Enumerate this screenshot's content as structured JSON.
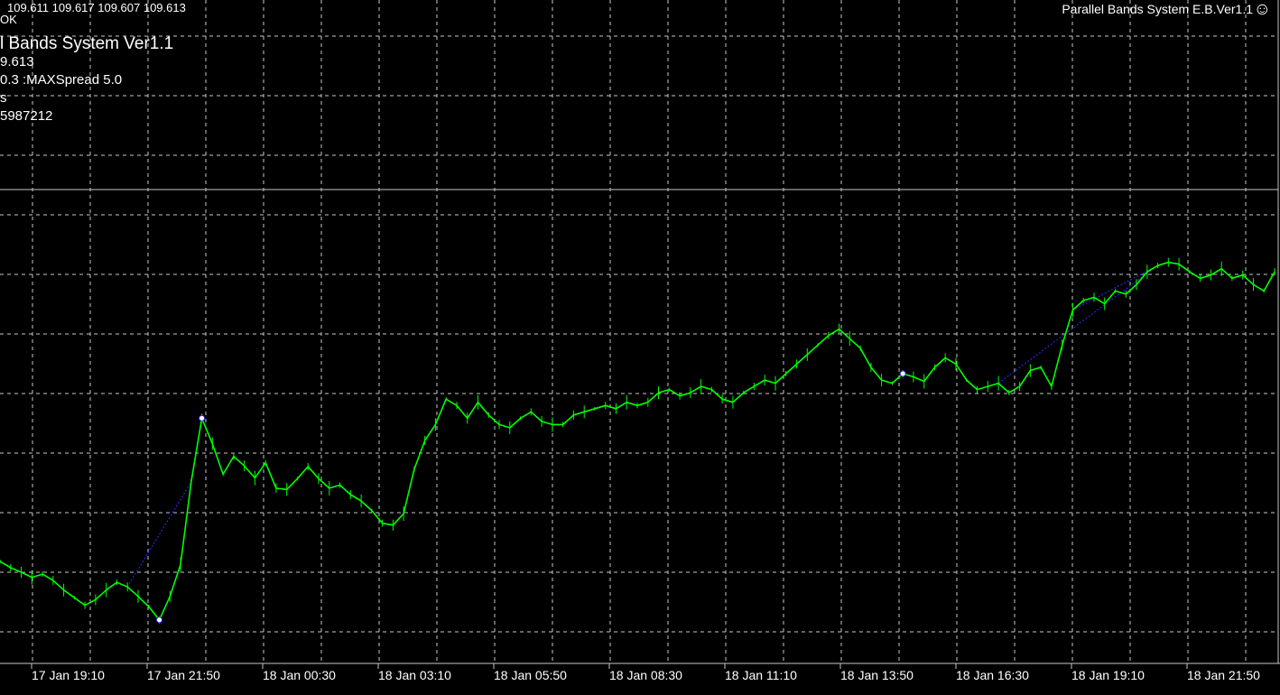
{
  "ohlc_readout": "109.611 109.617 109.607 109.613",
  "status_text": "OK",
  "ea_title": "l Bands System Ver1.1",
  "info_lines": [
    "9.613",
    "0.3  :MAXSpread  5.0",
    "s",
    "5987212"
  ],
  "ea_name": "Parallel Bands System E.B.Ver1.1",
  "smiley_icon": "smiley-face-icon",
  "colors": {
    "background": "#000000",
    "grid": "#c8c8c8",
    "price": "#00ff00",
    "trade_line": "#3030ff",
    "text": "#ffffff"
  },
  "chart_data": {
    "type": "line",
    "x_tick_labels": [
      "17 Jan 19:10",
      "17 Jan 21:50",
      "18 Jan 00:30",
      "18 Jan 03:10",
      "18 Jan 05:50",
      "18 Jan 08:30",
      "18 Jan 11:10",
      "18 Jan 13:50",
      "18 Jan 16:30",
      "18 Jan 19:10",
      "18 Jan 21:50"
    ],
    "grid": true,
    "series": [
      {
        "values": [
          -9.5,
          -10.5,
          -11.2,
          -12,
          -11.5,
          -12.5,
          -14,
          -15.2,
          -16.4,
          -15.5,
          -14,
          -12.8,
          -13.5,
          -15,
          -16.6,
          -18.7,
          -15,
          -10,
          3,
          13,
          9,
          4.2,
          7,
          5.5,
          3.6,
          6,
          2,
          1.8,
          3.5,
          5.4,
          3.5,
          2,
          2.5,
          1,
          0,
          -1.5,
          -3.5,
          -3.8,
          -2,
          5,
          9.5,
          12,
          16,
          15,
          13,
          15.5,
          13.5,
          12,
          11.5,
          13,
          14,
          12.5,
          12,
          12,
          13.5,
          14,
          14.5,
          15,
          14.5,
          15.5,
          15,
          15.5,
          17,
          17.5,
          16.5,
          17,
          18,
          17.5,
          16,
          15.5,
          17,
          18,
          19,
          18.5,
          20,
          21.5,
          23,
          24.5,
          26,
          27,
          25.5,
          24,
          21,
          19,
          18.5,
          20,
          19.5,
          18.8,
          21,
          22.5,
          21.5,
          19,
          17.5,
          18,
          18.5,
          17,
          18,
          20.5,
          21,
          18,
          24.5,
          30,
          31.5,
          32,
          31,
          33,
          32.5,
          34,
          36,
          37,
          37.5,
          37.2,
          36,
          35,
          35.5,
          36.5,
          35,
          35.5,
          34,
          33,
          36
        ]
      }
    ]
  }
}
